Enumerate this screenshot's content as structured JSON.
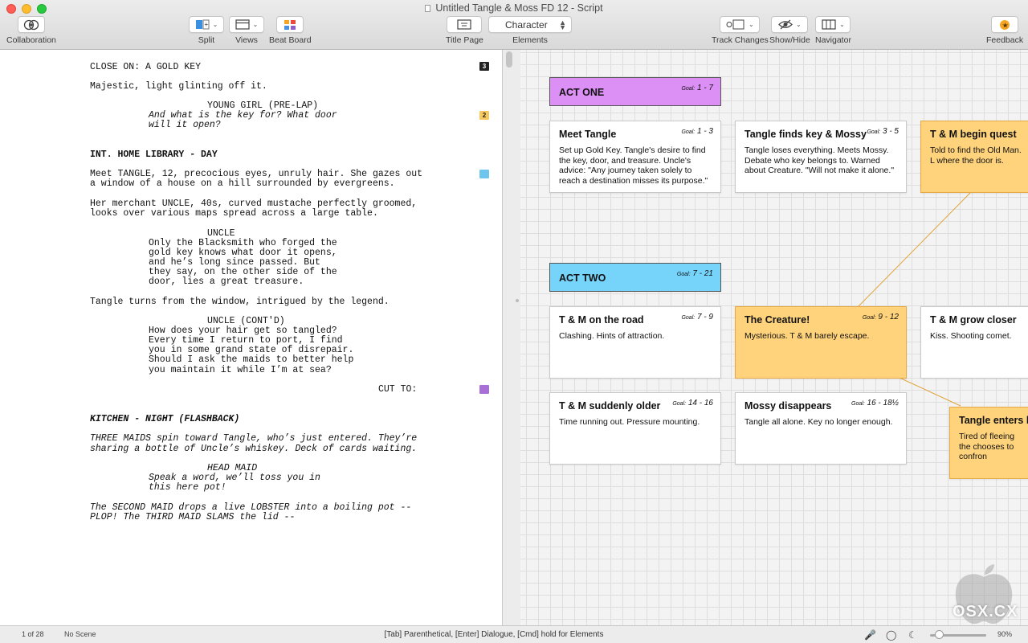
{
  "window": {
    "title": "Untitled Tangle & Moss FD 12 - Script"
  },
  "toolbar": {
    "collaboration": "Collaboration",
    "split": "Split",
    "views": "Views",
    "beat_board": "Beat Board",
    "title_page": "Title Page",
    "elements_value": "Character",
    "elements": "Elements",
    "track_changes": "Track Changes",
    "show_hide": "Show/Hide",
    "navigator": "Navigator",
    "feedback": "Feedback"
  },
  "script": {
    "lines": [
      "CLOSE ON: A GOLD KEY",
      "Majestic, light glinting off it.",
      "YOUNG GIRL (PRE-LAP)",
      "And what is the key for? What door",
      "will it open?",
      "INT. HOME LIBRARY - DAY",
      "Meet TANGLE, 12, precocious eyes, unruly hair. She gazes out",
      "a window of a house on a hill surrounded by evergreens.",
      "Her merchant UNCLE, 40s, curved mustache perfectly groomed,",
      "looks over various maps spread across a large table.",
      "UNCLE",
      "Only the Blacksmith who forged the",
      "gold key knows what door it opens,",
      "and he’s long since passed. But",
      "they say, on the other side of the",
      "door, lies a great treasure.",
      "Tangle turns from the window, intrigued by the legend.",
      "UNCLE (CONT'D)",
      "How does your hair get so tangled?",
      "Every time I return to port, I find",
      "you in some grand state of disrepair.",
      "Should I ask the maids to better help",
      "you maintain it while I’m at sea?",
      "CUT TO:",
      "KITCHEN - NIGHT (FLASHBACK)",
      "THREE MAIDS spin toward Tangle, who’s just entered. They’re",
      "sharing a bottle of Uncle’s whiskey. Deck of cards waiting.",
      "HEAD MAID",
      "Speak a word, we’ll toss you in",
      "this here pot!",
      "The SECOND MAID drops a live LOBSTER into a boiling pot --",
      "PLOP! The THIRD MAID SLAMS the lid --"
    ],
    "flags": [
      "3",
      "2"
    ]
  },
  "acts": [
    {
      "title": "ACT ONE",
      "goal_label": "Goal:",
      "goal": "1 - 7",
      "color": "#dc8ff5"
    },
    {
      "title": "ACT TWO",
      "goal_label": "Goal:",
      "goal": "7 - 21",
      "color": "#76d4fb"
    }
  ],
  "cards": [
    {
      "title": "Meet Tangle",
      "goal_label": "Goal:",
      "goal": "1 - 3",
      "body": "Set up Gold Key. Tangle's desire to find the key, door, and treasure. Uncle's advice: \"Any journey taken solely to reach a destination misses its purpose.\""
    },
    {
      "title": "Tangle finds key & Mossy",
      "goal_label": "Goal:",
      "goal": "3 - 5",
      "body": "Tangle loses everything. Meets Mossy. Debate who key belongs to. Warned about Creature. \"Will not make it alone.\""
    },
    {
      "title": "T & M begin quest",
      "goal_label": "",
      "goal": "",
      "body": "Told to find the Old Man. L where the door is."
    },
    {
      "title": "T & M on the road",
      "goal_label": "Goal:",
      "goal": "7 - 9",
      "body": "Clashing. Hints of attraction."
    },
    {
      "title": "The Creature!",
      "goal_label": "Goal:",
      "goal": "9 - 12",
      "body": "Mysterious. T & M barely escape."
    },
    {
      "title": "T & M grow closer",
      "goal_label": "",
      "goal": "",
      "body": "Kiss. Shooting comet."
    },
    {
      "title": "T & M suddenly older",
      "goal_label": "Goal:",
      "goal": "14 - 16",
      "body": "Time running out. Pressure mounting."
    },
    {
      "title": "Mossy disappears",
      "goal_label": "Goal:",
      "goal": "16 - 18½",
      "body": "Tangle all alone. Key no longer enough."
    },
    {
      "title": "Tangle enters la",
      "goal_label": "",
      "goal": "",
      "body": "Tired of fleeing the chooses to confron"
    }
  ],
  "status": {
    "page": "1 of 28",
    "scene": "No Scene",
    "hint": "[Tab]  Parenthetical,  [Enter] Dialogue, [Cmd] hold for Elements",
    "zoom": "90%"
  },
  "watermark": "OSX.CX",
  "colors": {
    "card_highlight": "#ffd37c",
    "link_line": "#e0a43a"
  }
}
